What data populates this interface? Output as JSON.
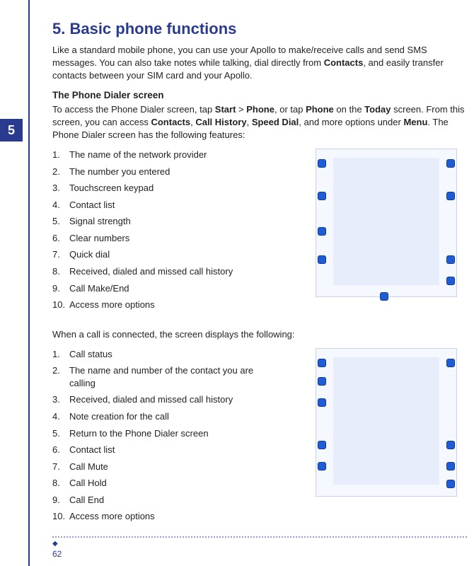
{
  "chapter_number": "5",
  "heading": "5. Basic phone functions",
  "intro_segments": [
    {
      "t": "Like a standard mobile phone, you can use your Apollo to make/receive calls and send SMS messages. You can also take notes while talking, dial directly from ",
      "b": false
    },
    {
      "t": "Contacts",
      "b": true
    },
    {
      "t": ", and easily transfer contacts between your SIM card and your Apollo.",
      "b": false
    }
  ],
  "subhead1": "The Phone Dialer screen",
  "para1_segments": [
    {
      "t": "To access the Phone Dialer screen, tap ",
      "b": false
    },
    {
      "t": "Start",
      "b": true
    },
    {
      "t": " > ",
      "b": false
    },
    {
      "t": "Phone",
      "b": true
    },
    {
      "t": ", or tap ",
      "b": false
    },
    {
      "t": "Phone",
      "b": true
    },
    {
      "t": " on the ",
      "b": false
    },
    {
      "t": "Today",
      "b": true
    },
    {
      "t": " screen. From this screen, you can access ",
      "b": false
    },
    {
      "t": "Contacts",
      "b": true
    },
    {
      "t": ", ",
      "b": false
    },
    {
      "t": "Call History",
      "b": true
    },
    {
      "t": ", ",
      "b": false
    },
    {
      "t": "Speed Dial",
      "b": true
    },
    {
      "t": ", and more options under ",
      "b": false
    },
    {
      "t": "Menu",
      "b": true
    },
    {
      "t": ". The Phone Dialer screen has the following features:",
      "b": false
    }
  ],
  "list1": [
    "The name of the network provider",
    "The number you entered",
    "Touchscreen keypad",
    "Contact list",
    "Signal strength",
    "Clear numbers",
    "Quick dial",
    "Received, dialed and missed call history",
    "Call Make/End",
    "Access more options"
  ],
  "midline": "When a call is connected, the screen displays the following:",
  "list2": [
    "Call status",
    "The name and number of the contact you are calling",
    "Received, dialed and missed call history",
    "Note creation for the call",
    "Return to the Phone Dialer screen",
    "Contact list",
    "Call Mute",
    "Call Hold",
    "Call End",
    "Access more options"
  ],
  "page_number": "62"
}
